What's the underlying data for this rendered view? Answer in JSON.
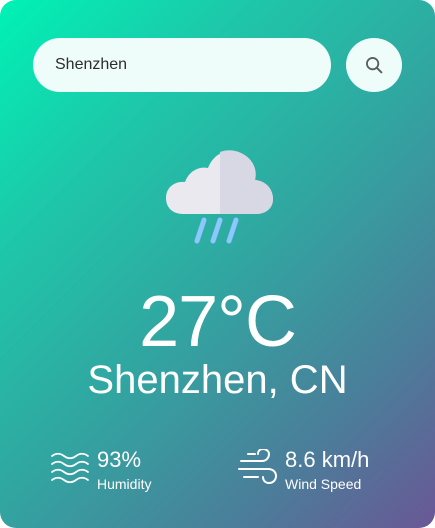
{
  "search": {
    "value": "Shenzhen",
    "button_icon": "search-icon"
  },
  "weather": {
    "icon": "rain-cloud-icon",
    "temperature": "27°C",
    "location": "Shenzhen, CN"
  },
  "details": {
    "humidity": {
      "icon": "waves-icon",
      "value": "93%",
      "label": "Humidity"
    },
    "wind": {
      "icon": "wind-icon",
      "value": "8.6 km/h",
      "label": "Wind Speed"
    }
  },
  "colors": {
    "gradient_start": "#00f2b6",
    "gradient_end": "#6a5796",
    "search_bg": "#eefdf9",
    "text": "#ffffff"
  }
}
